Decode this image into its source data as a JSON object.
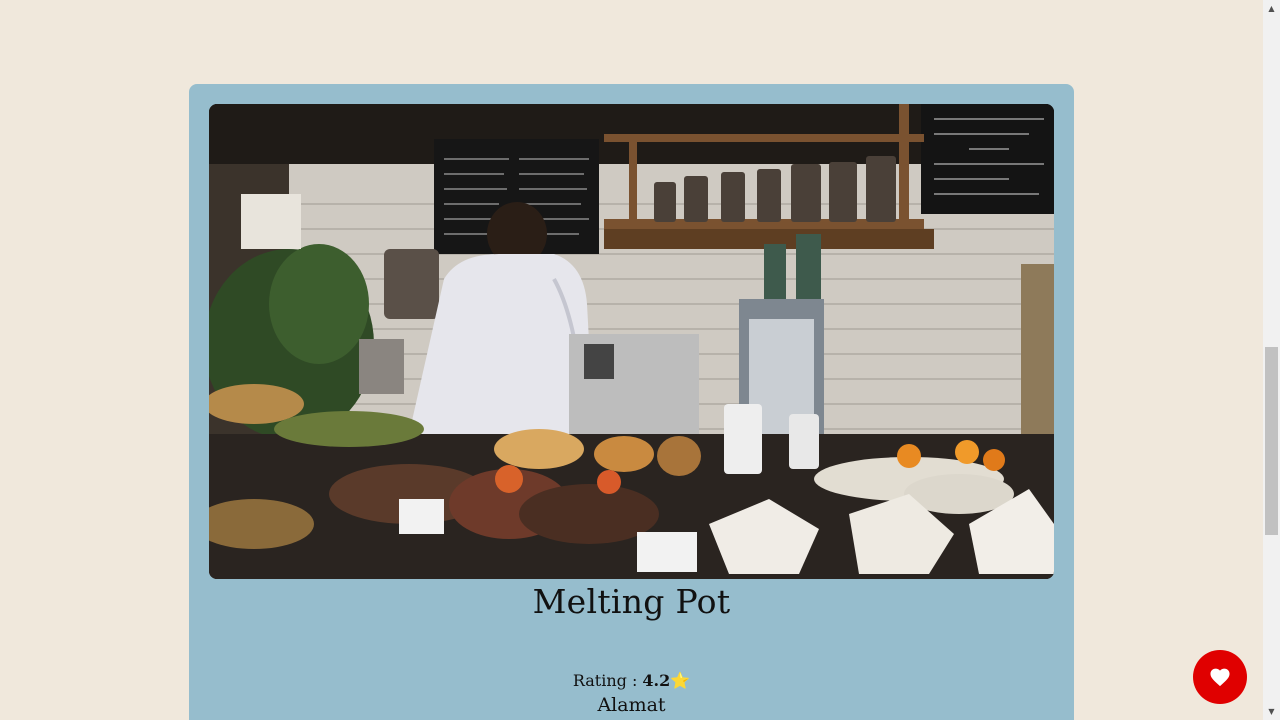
{
  "card": {
    "image_alt": "cafe counter with barista",
    "title": "Melting Pot",
    "rating_label": "Rating : ",
    "rating_value": "4.2",
    "rating_icon": "star-icon",
    "address": "Alamat"
  },
  "fab": {
    "icon": "heart-icon"
  },
  "colors": {
    "page_bg": "#f0e8dc",
    "card_bg": "#96bdcd",
    "fab_bg": "#e00000"
  }
}
